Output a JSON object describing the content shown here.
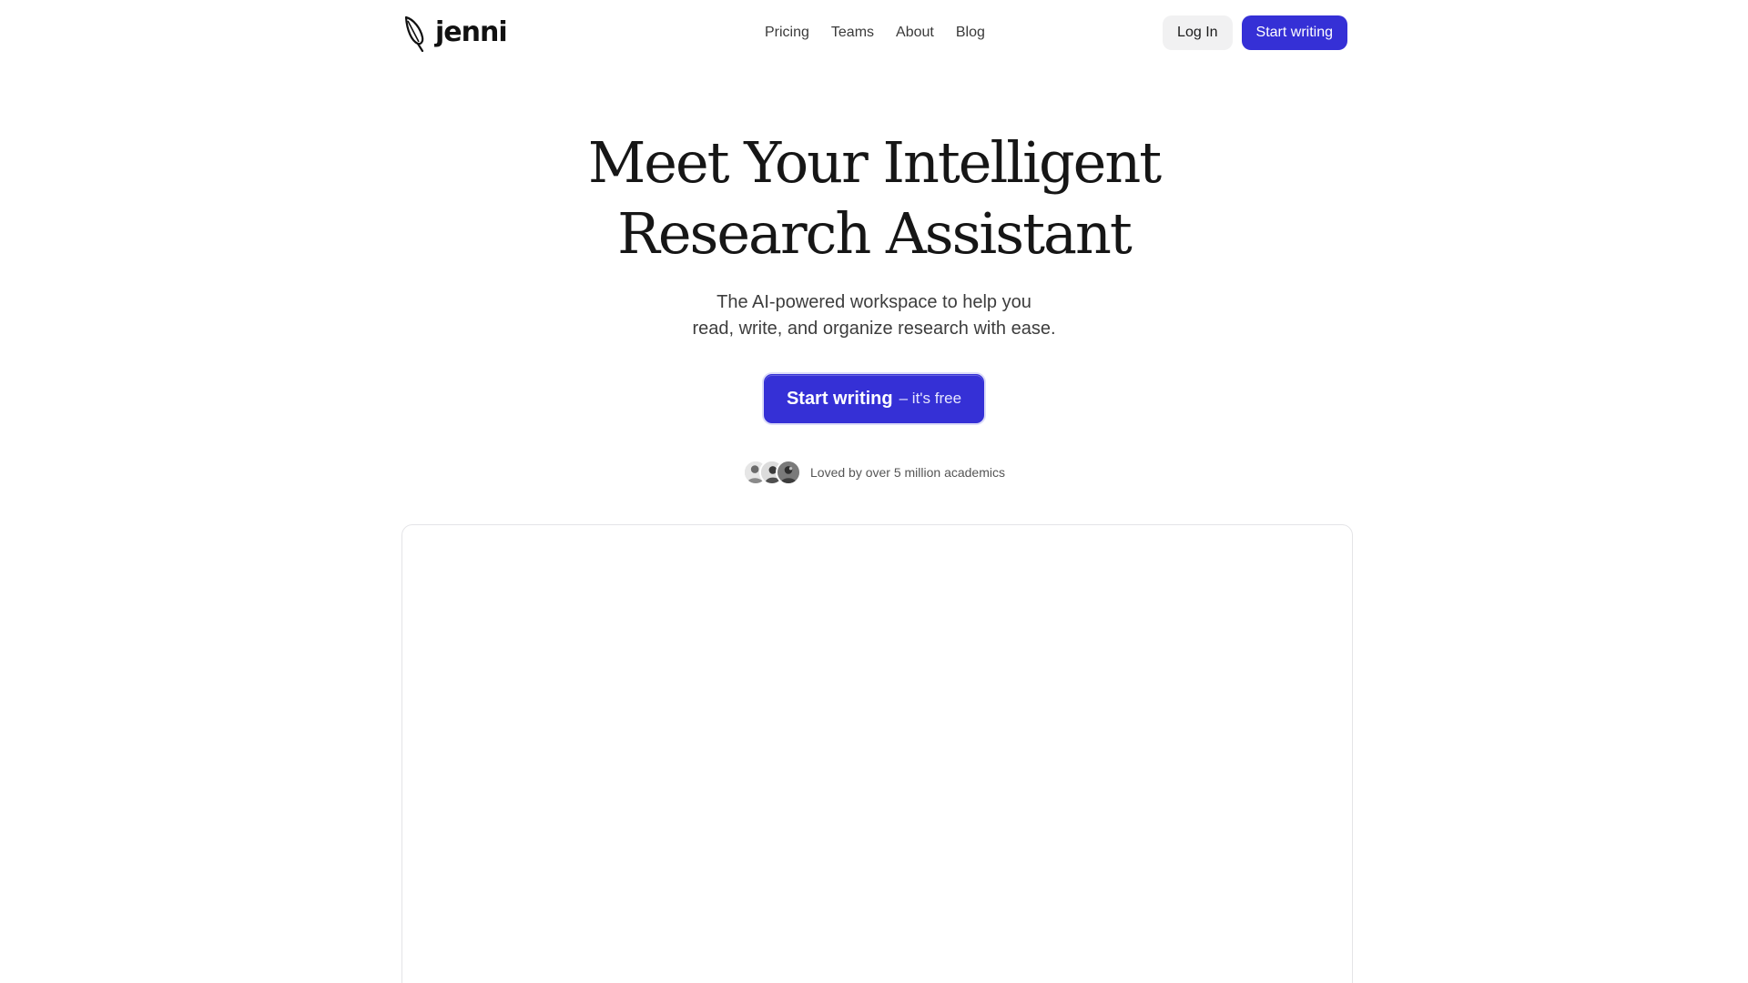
{
  "brand": {
    "name": "jenni",
    "logo_icon": "quill-icon"
  },
  "nav": {
    "items": [
      {
        "label": "Pricing"
      },
      {
        "label": "Teams"
      },
      {
        "label": "About"
      },
      {
        "label": "Blog"
      }
    ]
  },
  "header_actions": {
    "login_label": "Log In",
    "start_label": "Start writing"
  },
  "hero": {
    "title_line1": "Meet Your Intelligent",
    "title_line2": "Research Assistant",
    "subtitle_line1": "The AI-powered workspace to help you",
    "subtitle_line2": "read, write, and organize research with ease.",
    "cta_main": "Start writing",
    "cta_suffix": "– it's free"
  },
  "social_proof": {
    "text": "Loved by over 5 million academics",
    "avatar_count": 3
  },
  "colors": {
    "accent": "#3530d6",
    "text": "#161616",
    "muted": "#555555",
    "border": "#e4e4e7"
  }
}
